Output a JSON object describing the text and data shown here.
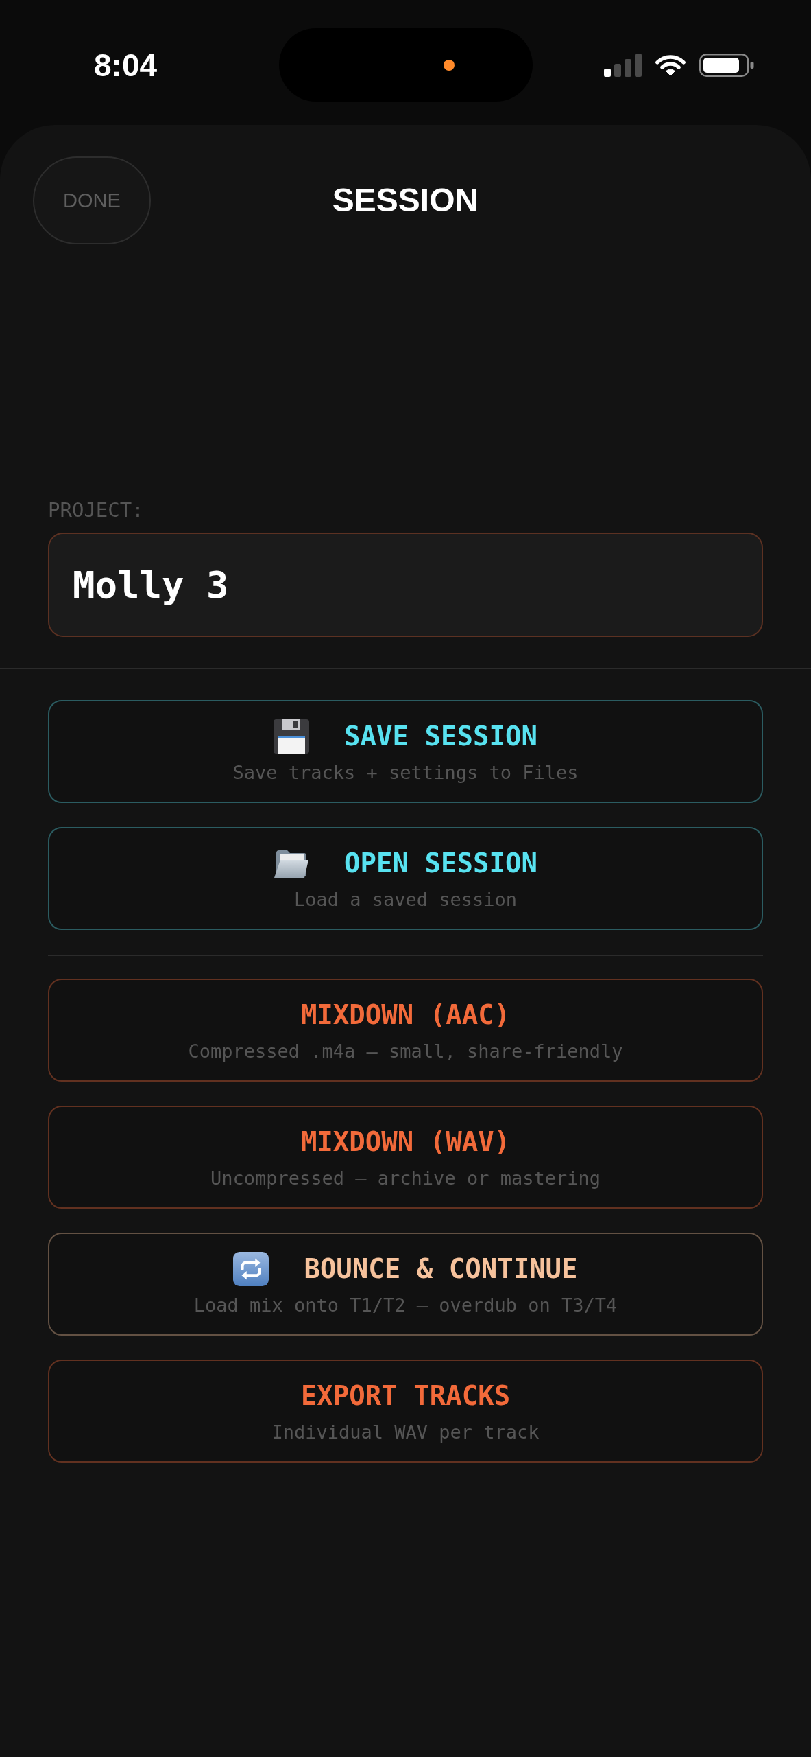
{
  "status_bar": {
    "time": "8:04"
  },
  "header": {
    "done_button": "DONE",
    "title": "SESSION"
  },
  "project": {
    "label": "PROJECT:",
    "value": "Molly 3"
  },
  "session_actions": [
    {
      "kind": "save",
      "label": "SAVE SESSION",
      "description": "Save tracks + settings to Files",
      "color": "#58e2f0"
    },
    {
      "kind": "open",
      "label": "OPEN SESSION",
      "description": "Load a saved session",
      "color": "#58e2f0"
    }
  ],
  "export_actions": [
    {
      "kind": "mixdown",
      "label": "MIXDOWN (AAC)",
      "description": "Compressed .m4a — small, share-friendly",
      "color": "#f26a3a"
    },
    {
      "kind": "mixdown",
      "label": "MIXDOWN (WAV)",
      "description": "Uncompressed — archive or mastering",
      "color": "#f26a3a"
    },
    {
      "kind": "bounce",
      "label": "BOUNCE & CONTINUE",
      "description": "Load mix onto T1/T2 — overdub on T3/T4",
      "color": "#f6c29c"
    },
    {
      "kind": "export",
      "label": "EXPORT TRACKS",
      "description": "Individual WAV per track",
      "color": "#f26a3a"
    }
  ]
}
